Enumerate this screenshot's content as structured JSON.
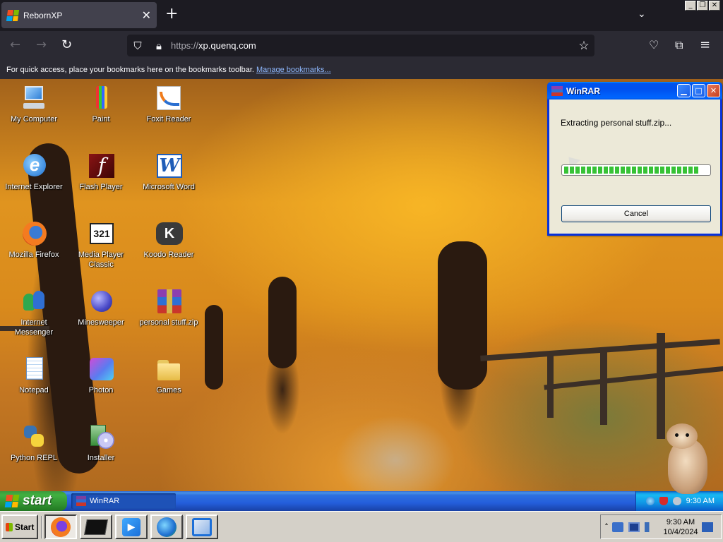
{
  "browser": {
    "tab_title": "RebornXP",
    "url_scheme": "https://",
    "url_host": "xp.quenq.com",
    "bookmarks_hint": "For quick access, place your bookmarks here on the bookmarks toolbar.",
    "bookmarks_link": "Manage bookmarks..."
  },
  "desktop": {
    "icons": [
      {
        "label": "My Computer"
      },
      {
        "label": "Paint"
      },
      {
        "label": "Foxit Reader"
      },
      {
        "label": "Internet Explorer"
      },
      {
        "label": "Flash Player"
      },
      {
        "label": "Microsoft Word"
      },
      {
        "label": "Mozilla Firefox"
      },
      {
        "label": "Media Player Classic"
      },
      {
        "label": "Koodo Reader"
      },
      {
        "label": "Internet Messenger"
      },
      {
        "label": "Minesweeper"
      },
      {
        "label": "personal stuff.zip"
      },
      {
        "label": "Notepad"
      },
      {
        "label": "Photon"
      },
      {
        "label": "Games"
      },
      {
        "label": "Python REPL"
      },
      {
        "label": "Installer"
      }
    ]
  },
  "winrar": {
    "title": "WinRAR",
    "message": "Extracting personal stuff.zip...",
    "progress": 0.93,
    "cancel_label": "Cancel"
  },
  "xp_taskbar": {
    "start_label": "start",
    "task_label": "WinRAR",
    "clock": "9:30 AM"
  },
  "host_taskbar": {
    "start_label": "Start",
    "time": "9:30 AM",
    "date": "10/4/2024"
  },
  "colors": {
    "xp_blue": "#245edb",
    "xp_green": "#3c9a3c",
    "progress_green": "#37c236",
    "browser_dark": "#1c1b22"
  }
}
